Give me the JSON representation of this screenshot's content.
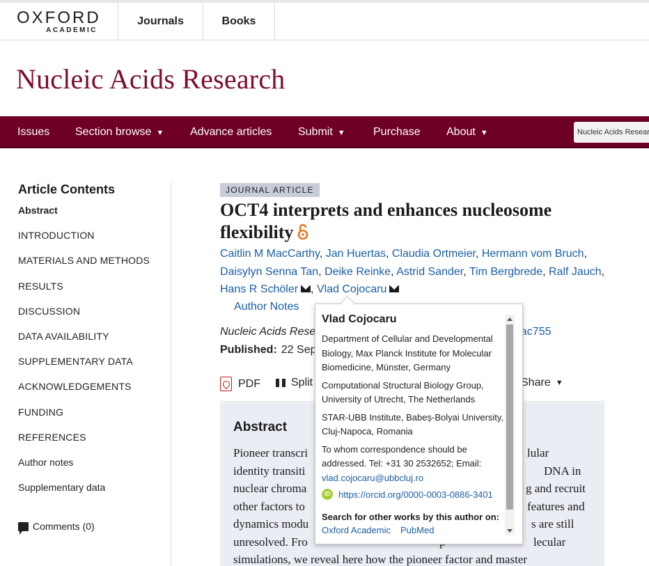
{
  "publisher": {
    "logo_top": "OXFORD",
    "logo_bottom": "ACADEMIC"
  },
  "top_tabs": [
    "Journals",
    "Books"
  ],
  "journal_title": "Nucleic Acids Research",
  "main_nav": {
    "items": [
      {
        "label": "Issues",
        "has_caret": false
      },
      {
        "label": "Section browse",
        "has_caret": true
      },
      {
        "label": "Advance articles",
        "has_caret": false
      },
      {
        "label": "Submit",
        "has_caret": true
      },
      {
        "label": "Purchase",
        "has_caret": false
      },
      {
        "label": "About",
        "has_caret": true
      }
    ],
    "caret": "▼",
    "search_scope": "Nucleic Acids Resear"
  },
  "sidebar": {
    "title": "Article Contents",
    "items": [
      "Abstract",
      "INTRODUCTION",
      "MATERIALS AND METHODS",
      "RESULTS",
      "DISCUSSION",
      "DATA AVAILABILITY",
      "SUPPLEMENTARY DATA",
      "ACKNOWLEDGEMENTS",
      "FUNDING",
      "REFERENCES",
      "Author notes",
      "Supplementary data"
    ],
    "comments": "Comments (0)"
  },
  "article": {
    "type_badge": "JOURNAL ARTICLE",
    "title_line1": "OCT4 interprets and enhances nucleosome",
    "title_line2": "flexibility",
    "authors_line1": [
      "Caitlin M MacCarthy",
      "Jan Huertas",
      "Claudia Ortmeier",
      "Hermann vom Bruch"
    ],
    "authors_line2": [
      "Daisylyn Senna Tan",
      "Deike Reinke",
      "Astrid Sander",
      "Tim Bergbrede",
      "Ralf Jauch"
    ],
    "authors_line3": [
      "Hans R Schöler",
      "Vlad Cojocaru"
    ],
    "author_notes": "Author Notes",
    "citation_visible": "Nucleic Acids Resea",
    "doi_visible": "gkac755",
    "published_label": "Published:",
    "published_visible": "22 Sep",
    "tools": {
      "pdf": "PDF",
      "split": "Split",
      "share": "Share"
    },
    "abstract_title": "Abstract",
    "abstract_lines": [
      {
        "left": "Pioneer transcri",
        "right": "lular"
      },
      {
        "left": "identity transiti",
        "right": "DNA in"
      },
      {
        "left": "nuclear chroma",
        "right": "g and recruit"
      },
      {
        "left": "other factors to",
        "right": "features and"
      },
      {
        "left": "dynamics modu",
        "right": "s are still"
      },
      {
        "left": "unresolved. Fro",
        "mid": "p",
        "right": "lecular"
      },
      {
        "left": "simulations, we reveal here how the pioneer factor and master",
        "right": ""
      }
    ]
  },
  "author_popup": {
    "name": "Vlad Cojocaru",
    "affiliations": [
      "Department of Cellular and Developmental Biology, Max Planck Institute for Molecular Biomedicine, Münster, Germany",
      "Computational Structural Biology Group, University of Utrecht, The Netherlands",
      "STAR-UBB Institute, Babeș-Bolyai University, Cluj-Napoca, Romania"
    ],
    "correspondence": "To whom correspondence should be addressed. Tel: +31 30 2532652; Email:",
    "email": "vlad.cojocaru@ubbcluj.ro",
    "orcid_label": "iD",
    "orcid_url": "https://orcid.org/0000-0003-0886-3401",
    "search_label": "Search for other works by this author on:",
    "search_links": [
      "Oxford Academic",
      "PubMed"
    ]
  },
  "colors": {
    "brand": "#7d0c2d",
    "nav_bg": "#6d0024",
    "link": "#1a5ea6",
    "badge_bg": "#c7ccd8",
    "abstract_bg": "#eaedf3"
  }
}
